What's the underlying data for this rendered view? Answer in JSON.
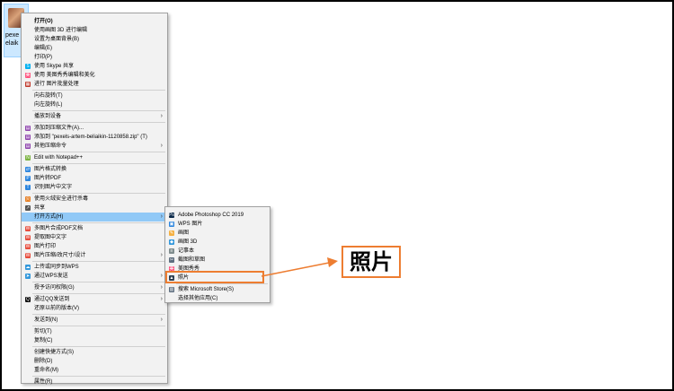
{
  "desktop_icon": {
    "label": "pexe\nelaik"
  },
  "main_menu": [
    {
      "label": "打开(O)",
      "bold": true,
      "icon": "none"
    },
    {
      "label": "使用画图 3D 进行编辑",
      "icon": "none"
    },
    {
      "label": "设置为桌面背景(B)",
      "icon": "none"
    },
    {
      "label": "编辑(E)",
      "icon": "none"
    },
    {
      "label": "打印(P)",
      "icon": "none"
    },
    {
      "label": "使用 Skype 共享",
      "icon": "skype-icon"
    },
    {
      "label": "使用 美图秀秀编辑和美化",
      "icon": "meitu-icon"
    },
    {
      "label": "进行 图片批量处理",
      "icon": "batch-icon"
    },
    {
      "sep": true
    },
    {
      "label": "向右旋转(T)",
      "icon": "none"
    },
    {
      "label": "向左旋转(L)",
      "icon": "none"
    },
    {
      "sep": true
    },
    {
      "label": "播放到设备",
      "icon": "none",
      "submenu": true
    },
    {
      "sep": true
    },
    {
      "label": "添加到压缩文件(A)...",
      "icon": "archive-icon"
    },
    {
      "label": "添加到 \"pexels-artem-beliaikin-1120858.zip\" (T)",
      "icon": "archive-icon"
    },
    {
      "label": "其他压缩命令",
      "icon": "archive-icon",
      "submenu": true
    },
    {
      "sep": true
    },
    {
      "label": "Edit with Notepad++",
      "icon": "notepadpp-icon"
    },
    {
      "sep": true
    },
    {
      "label": "图片格式转换",
      "icon": "convert-icon"
    },
    {
      "label": "图片转PDF",
      "icon": "pdf-icon"
    },
    {
      "label": "识别图片中文字",
      "icon": "ocr-icon"
    },
    {
      "sep": true
    },
    {
      "label": "使用火绒安全进行杀毒",
      "icon": "huorong-icon"
    },
    {
      "label": "共享",
      "icon": "share-icon"
    },
    {
      "label": "打开方式(H)",
      "icon": "none",
      "submenu": true,
      "highlight": true
    },
    {
      "sep": true
    },
    {
      "label": "多图片合成PDF文档",
      "icon": "wps-icon"
    },
    {
      "label": "提取图中文字",
      "icon": "wps-icon"
    },
    {
      "label": "图片打印",
      "icon": "wps-icon"
    },
    {
      "label": "图片压缩/改尺寸/设计",
      "icon": "wps-icon",
      "submenu": true
    },
    {
      "sep": true
    },
    {
      "label": "上传或同步到WPS",
      "icon": "wps-cloud-icon"
    },
    {
      "label": "通过WPS发送",
      "icon": "wps-send-icon",
      "submenu": true
    },
    {
      "sep": true
    },
    {
      "label": "授予访问权限(G)",
      "icon": "none",
      "submenu": true
    },
    {
      "sep": true
    },
    {
      "label": "通过QQ发送到",
      "icon": "qq-icon",
      "submenu": true
    },
    {
      "label": "还原以前的版本(V)",
      "icon": "none"
    },
    {
      "sep": true
    },
    {
      "label": "发送到(N)",
      "icon": "none",
      "submenu": true
    },
    {
      "sep": true
    },
    {
      "label": "剪切(T)",
      "icon": "none"
    },
    {
      "label": "复制(C)",
      "icon": "none"
    },
    {
      "sep": true
    },
    {
      "label": "创建快捷方式(S)",
      "icon": "none"
    },
    {
      "label": "删除(D)",
      "icon": "none"
    },
    {
      "label": "重命名(M)",
      "icon": "none"
    },
    {
      "sep": true
    },
    {
      "label": "属性(R)",
      "icon": "none"
    }
  ],
  "open_with_menu": [
    {
      "label": "Adobe Photoshop CC 2019",
      "icon": "photoshop-icon"
    },
    {
      "label": "WPS 图片",
      "icon": "wps-image-icon"
    },
    {
      "label": "画图",
      "icon": "paint-icon"
    },
    {
      "label": "画图 3D",
      "icon": "paint3d-icon"
    },
    {
      "label": "记事本",
      "icon": "notepad-icon"
    },
    {
      "label": "截图和草图",
      "icon": "snip-icon"
    },
    {
      "label": "美图秀秀",
      "icon": "meitu-icon"
    },
    {
      "label": "照片",
      "icon": "photos-icon"
    },
    {
      "sep": true
    },
    {
      "label": "搜索 Microsoft Store(S)",
      "icon": "store-icon"
    },
    {
      "label": "选择其他应用(C)",
      "icon": "none"
    }
  ],
  "callout": {
    "text": "照片"
  },
  "colors": {
    "annotation": "#ed7d31",
    "menu_bg": "#f2f2f2",
    "hover": "#91c9f7"
  }
}
